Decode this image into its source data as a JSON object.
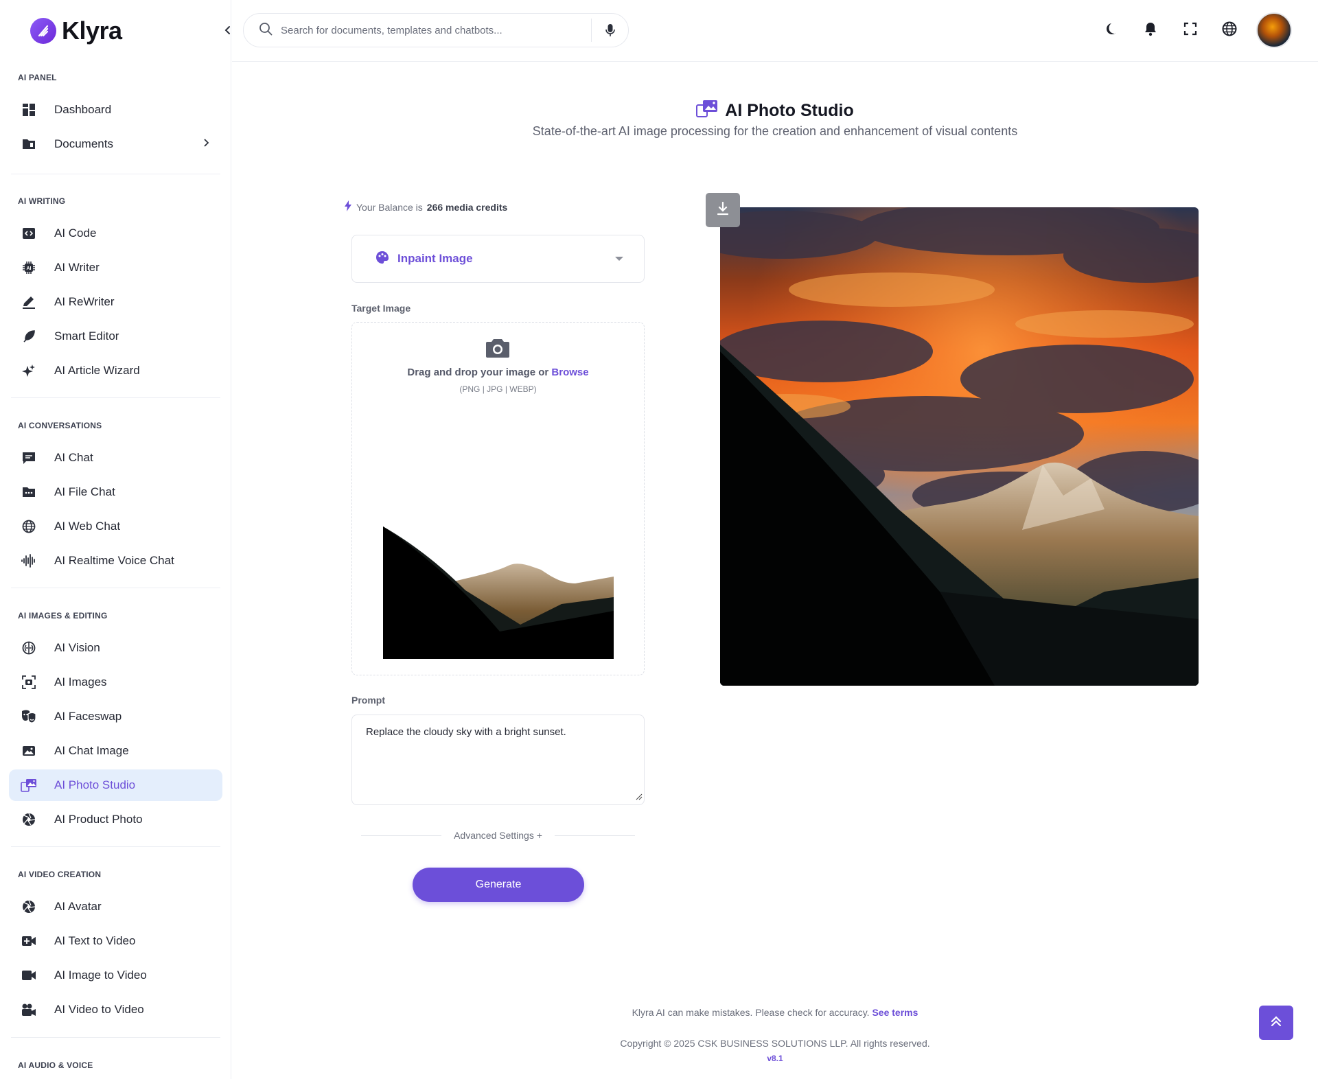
{
  "brand": {
    "name": "Klyra"
  },
  "search": {
    "placeholder": "Search for documents, templates and chatbots..."
  },
  "sidebar": {
    "sections": {
      "ai_panel": "AI PANEL",
      "ai_writing": "AI WRITING",
      "ai_conversations": "AI CONVERSATIONS",
      "ai_images": "AI IMAGES & EDITING",
      "ai_video": "AI VIDEO CREATION",
      "ai_audio": "AI AUDIO & VOICE"
    },
    "items": {
      "dashboard": "Dashboard",
      "documents": "Documents",
      "ai_code": "AI Code",
      "ai_writer": "AI Writer",
      "ai_rewriter": "AI ReWriter",
      "smart_editor": "Smart Editor",
      "ai_article_wizard": "AI Article Wizard",
      "ai_chat": "AI Chat",
      "ai_file_chat": "AI File Chat",
      "ai_web_chat": "AI Web Chat",
      "ai_realtime_voice_chat": "AI Realtime Voice Chat",
      "ai_vision": "AI Vision",
      "ai_images": "AI Images",
      "ai_faceswap": "AI Faceswap",
      "ai_chat_image": "AI Chat Image",
      "ai_photo_studio": "AI Photo Studio",
      "ai_product_photo": "AI Product Photo",
      "ai_avatar": "AI Avatar",
      "ai_text_to_video": "AI Text to Video",
      "ai_image_to_video": "AI Image to Video",
      "ai_video_to_video": "AI Video to Video"
    },
    "active": "ai_photo_studio"
  },
  "main": {
    "title": "AI Photo Studio",
    "subtitle": "State-of-the-art AI image processing for the creation and enhancement of visual contents",
    "balance_prefix": "Your Balance is",
    "balance_value": "266 media credits",
    "mode": "Inpaint Image",
    "target_image_label": "Target Image",
    "dropzone_text": "Drag and drop your image or",
    "dropzone_browse": "Browse",
    "dropzone_types": "(PNG | JPG | WEBP)",
    "prompt_label": "Prompt",
    "prompt_value": "Replace the cloudy sky with a bright sunset.",
    "advanced_settings": "Advanced Settings +",
    "generate_label": "Generate"
  },
  "footer": {
    "disclaimer": "Klyra AI can make mistakes. Please check for accuracy.",
    "terms": "See terms",
    "copyright": "Copyright © 2025 CSK BUSINESS SOLUTIONS LLP. All rights reserved.",
    "version": "v8.1"
  },
  "colors": {
    "accent": "#6c4fd9",
    "active_bg": "#e4eefc"
  }
}
